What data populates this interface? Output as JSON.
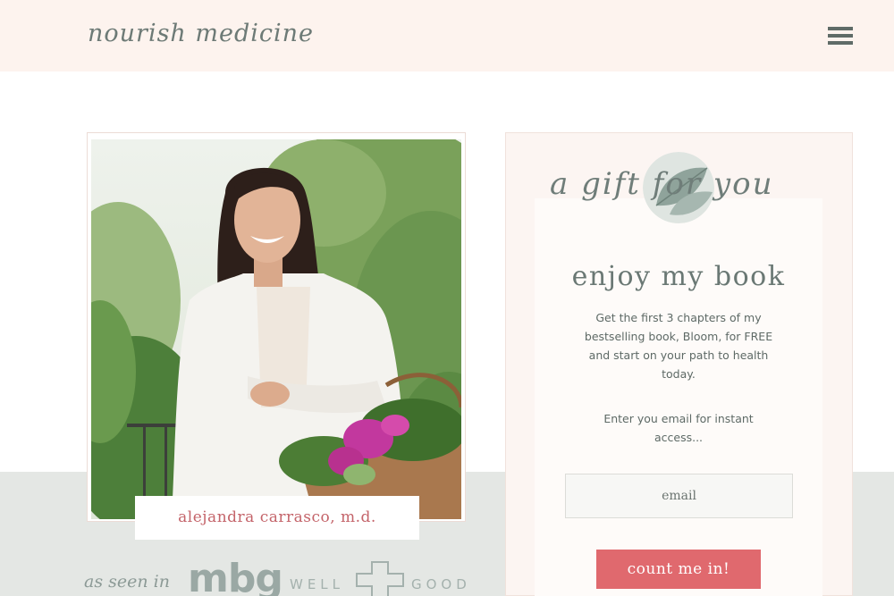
{
  "header": {
    "logo_text": "nourish medicine",
    "menu_icon": "hamburger-menu-icon"
  },
  "profile": {
    "name": "alejandra carrasco, m.d."
  },
  "press": {
    "label": "as seen in",
    "logos": [
      "mbg",
      "WELL",
      "GOOD"
    ]
  },
  "gift": {
    "script_title": "a gift for you",
    "heading": "enjoy my book",
    "description": "Get the first 3 chapters of my bestselling book, Bloom, for FREE and start on your path to health today.",
    "email_hint": "Enter you email for instant access...",
    "email_placeholder": "email",
    "button_label": "count me in!"
  },
  "colors": {
    "header_bg": "#fdf3ee",
    "accent": "#e0696e",
    "name_color": "#c4646a",
    "band_gray": "#e4e7e4"
  }
}
